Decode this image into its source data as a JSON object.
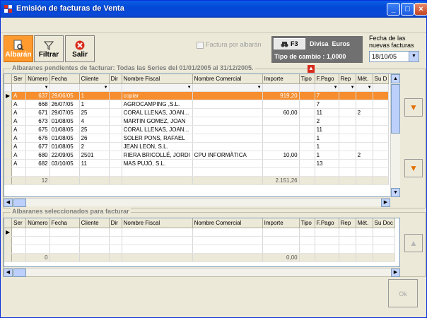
{
  "window": {
    "title": "Emisión de facturas de Venta",
    "minimize": "_",
    "maximize": "□",
    "close": "×"
  },
  "toolbar": {
    "albaran_label": "Albarán",
    "filtrar_label": "Filtrar",
    "salir_label": "Salir"
  },
  "factura_por_albaran": "Factura por albarán",
  "divisa": {
    "f3_label": "F3",
    "divisa_label": "Divisa",
    "divisa_value": "Euros",
    "tipo_cambio": "Tipo de cambio : 1,0000"
  },
  "fecha": {
    "label": "Fecha de las nuevas facturas",
    "value": "18/10/05"
  },
  "pending": {
    "title": "Albaranes pendientes de facturar:  Todas las Series  del 01/01/2005 al 31/12/2005.",
    "columns": [
      "Ser",
      "Número",
      "Fecha",
      "Cliente",
      "Dir",
      "Nombre Fiscal",
      "Nombre Comercial",
      "Importe",
      "Tipo",
      "F.Pago",
      "Rep",
      "Mét.",
      "Su D"
    ],
    "rows": [
      [
        "A",
        "637",
        "29/06/05",
        "1",
        "",
        "copiar",
        "",
        "919,20",
        "",
        "7",
        "",
        "",
        ""
      ],
      [
        "A",
        "668",
        "26/07/05",
        "1",
        "",
        "AGROCAMPING ,S.L.",
        "",
        "",
        "",
        "7",
        "",
        "",
        ""
      ],
      [
        "A",
        "671",
        "29/07/05",
        "25",
        "",
        "CORAL LLENAS, JOAN...",
        "",
        "60,00",
        "",
        "11",
        "",
        "2",
        ""
      ],
      [
        "A",
        "673",
        "01/08/05",
        "4",
        "",
        "MARTIN GOMEZ, JOAN",
        "",
        "",
        "",
        "2",
        "",
        "",
        ""
      ],
      [
        "A",
        "675",
        "01/08/05",
        "25",
        "",
        "CORAL LLENAS, JOAN...",
        "",
        "",
        "",
        "11",
        "",
        "",
        ""
      ],
      [
        "A",
        "676",
        "01/08/05",
        "26",
        "",
        "SOLER PONS, RAFAEL",
        "",
        "",
        "",
        "1",
        "",
        "",
        ""
      ],
      [
        "A",
        "677",
        "01/08/05",
        "2",
        "",
        "JEAN LEON, S.L.",
        "",
        "",
        "",
        "1",
        "",
        "",
        ""
      ],
      [
        "A",
        "680",
        "22/09/05",
        "2501",
        "",
        "RIERA BRICOLLÉ, JORDI",
        "CPU INFORMÀTICA",
        "10,00",
        "",
        "1",
        "",
        "2",
        ""
      ],
      [
        "A",
        "682",
        "03/10/05",
        "11",
        "",
        "MAS PUJÓ, S.L.",
        "",
        "",
        "",
        "13",
        "",
        "",
        ""
      ]
    ],
    "total_count": "12",
    "total_importe": "2.151,26"
  },
  "selected": {
    "title": "Albaranes seleccionados para facturar",
    "columns": [
      "Ser",
      "Número",
      "Fecha",
      "Cliente",
      "Dir",
      "Nombre Fiscal",
      "Nombre Comercial",
      "Importe",
      "Tipo",
      "F.Pago",
      "Rep",
      "Mét.",
      "Su Doc"
    ],
    "total_count": "0",
    "total_importe": "0,00"
  },
  "ok_label": "Ok"
}
